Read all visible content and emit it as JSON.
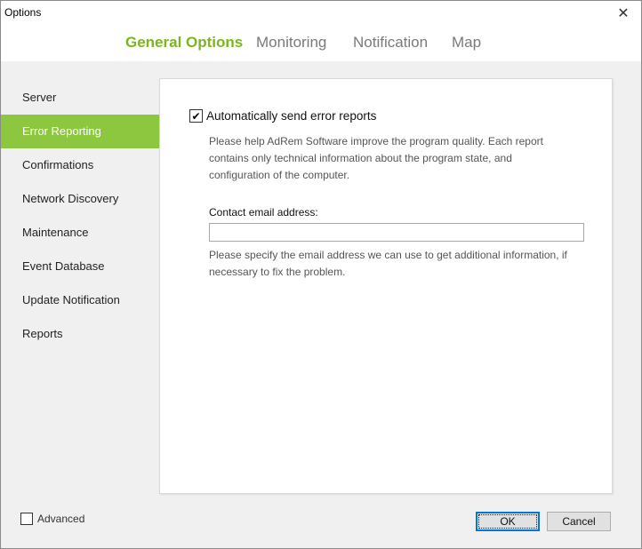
{
  "window": {
    "title": "Options",
    "close_glyph": "✕"
  },
  "tabs": [
    {
      "label": "General Options",
      "active": true
    },
    {
      "label": "Monitoring",
      "active": false
    },
    {
      "label": "Notification",
      "active": false
    },
    {
      "label": "Map",
      "active": false
    }
  ],
  "sidebar": {
    "items": [
      {
        "label": "Server",
        "active": false
      },
      {
        "label": "Error Reporting",
        "active": true
      },
      {
        "label": "Confirmations",
        "active": false
      },
      {
        "label": "Network Discovery",
        "active": false
      },
      {
        "label": "Maintenance",
        "active": false
      },
      {
        "label": "Event Database",
        "active": false
      },
      {
        "label": "Update Notification",
        "active": false
      },
      {
        "label": "Reports",
        "active": false
      }
    ]
  },
  "panel": {
    "auto_send": {
      "checked": true,
      "glyph": "✔",
      "label": "Automatically send error reports"
    },
    "description": "Please help AdRem Software improve the program quality. Each report contains only technical information about the program state, and configuration of the computer.",
    "email_label": "Contact email address:",
    "email_value": "",
    "email_hint": "Please specify the email address we can use to get additional information, if necessary to fix the problem."
  },
  "footer": {
    "advanced_label": "Advanced",
    "advanced_checked": false,
    "ok_label": "OK",
    "cancel_label": "Cancel"
  },
  "colors": {
    "accent": "#8dc63f",
    "active_tab": "#7ab61f",
    "inactive_tab": "#7a7a7a",
    "background": "#f0f0f0"
  }
}
